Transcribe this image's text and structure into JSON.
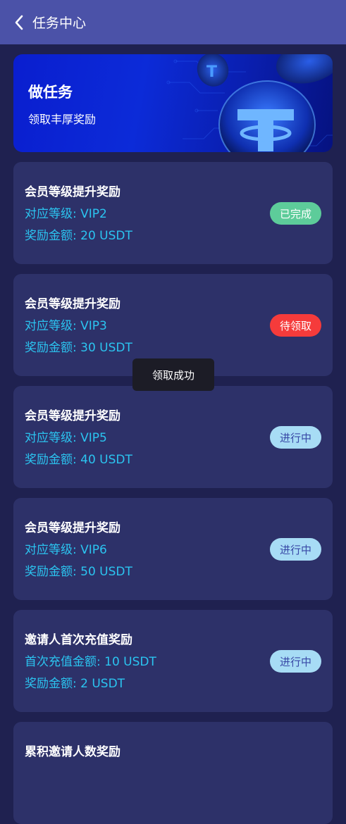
{
  "header": {
    "title": "任务中心"
  },
  "banner": {
    "title": "做任务",
    "subtitle": "领取丰厚奖励"
  },
  "tasks": [
    {
      "title": "会员等级提升奖励",
      "line1": "对应等级: VIP2",
      "line2": "奖励金额: 20 USDT",
      "status": "已完成",
      "status_type": "done"
    },
    {
      "title": "会员等级提升奖励",
      "line1": "对应等级: VIP3",
      "line2": "奖励金额: 30 USDT",
      "status": "待领取",
      "status_type": "claim"
    },
    {
      "title": "会员等级提升奖励",
      "line1": "对应等级: VIP5",
      "line2": "奖励金额: 40 USDT",
      "status": "进行中",
      "status_type": "progress"
    },
    {
      "title": "会员等级提升奖励",
      "line1": "对应等级: VIP6",
      "line2": "奖励金额: 50 USDT",
      "status": "进行中",
      "status_type": "progress"
    },
    {
      "title": "邀请人首次充值奖励",
      "line1": "首次充值金额: 10 USDT",
      "line2": "奖励金额: 2 USDT",
      "status": "进行中",
      "status_type": "progress"
    },
    {
      "title": "累积邀请人数奖励",
      "line1": "",
      "line2": "",
      "status": "",
      "status_type": ""
    }
  ],
  "toast": {
    "message": "领取成功"
  },
  "colors": {
    "header_bg": "#4b52a8",
    "page_bg": "#1f2150",
    "card_bg": "#2d3169",
    "accent_text": "#2bc4f0",
    "done": "#5dcc9a",
    "claim": "#f53b3b",
    "progress": "#a7dcf5"
  },
  "icons": {
    "back": "chevron-left-icon",
    "coin": "tether-coin-icon"
  }
}
